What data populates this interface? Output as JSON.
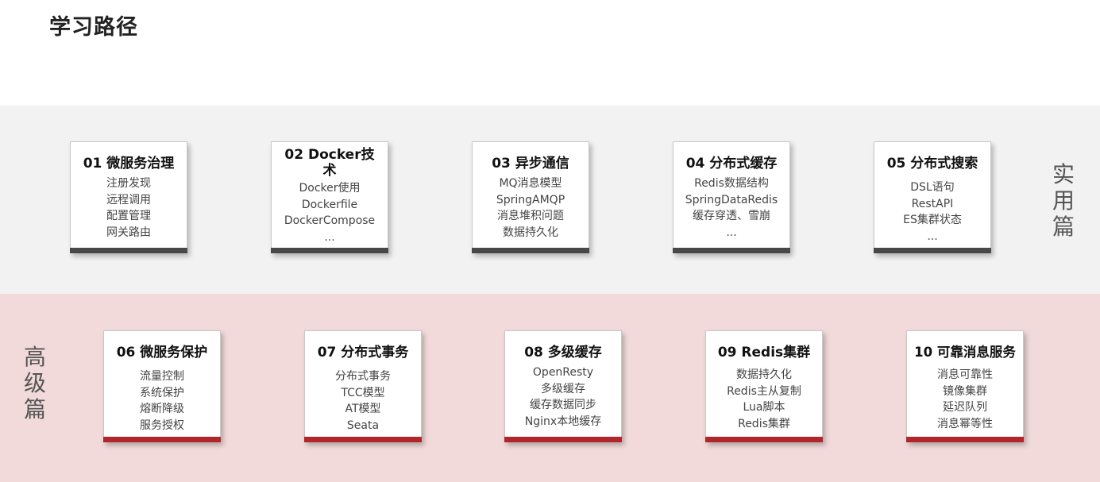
{
  "page": {
    "title": "学习路径"
  },
  "sections": {
    "practical": {
      "label": [
        "实",
        "用",
        "篇"
      ]
    },
    "advanced": {
      "label": [
        "高",
        "级",
        "篇"
      ]
    }
  },
  "cards": [
    {
      "title": "01 微服务治理",
      "items": [
        "注册发现",
        "远程调用",
        "配置管理",
        "网关路由"
      ]
    },
    {
      "title": "02 Docker技术",
      "items": [
        "Docker使用",
        "Dockerfile",
        "DockerCompose",
        "..."
      ]
    },
    {
      "title": "03 异步通信",
      "items": [
        "MQ消息模型",
        "SpringAMQP",
        "消息堆积问题",
        "数据持久化"
      ]
    },
    {
      "title": "04 分布式缓存",
      "items": [
        "Redis数据结构",
        "SpringDataRedis",
        "缓存穿透、雪崩",
        "..."
      ]
    },
    {
      "title": "05 分布式搜索",
      "items": [
        "DSL语句",
        "RestAPI",
        "ES集群状态",
        "..."
      ]
    },
    {
      "title": "06 微服务保护",
      "items": [
        "流量控制",
        "系统保护",
        "熔断降级",
        "服务授权"
      ]
    },
    {
      "title": "07 分布式事务",
      "items": [
        "分布式事务",
        "TCC模型",
        "AT模型",
        "Seata"
      ]
    },
    {
      "title": "08 多级缓存",
      "items": [
        "OpenResty",
        "多级缓存",
        "缓存数据同步",
        "Nginx本地缓存"
      ]
    },
    {
      "title": "09 Redis集群",
      "items": [
        "数据持久化",
        "Redis主从复制",
        "Lua脚本",
        "Redis集群"
      ]
    },
    {
      "title": "10 可靠消息服务",
      "items": [
        "消息可靠性",
        "镜像集群",
        "延迟队列",
        "消息幂等性"
      ]
    }
  ]
}
